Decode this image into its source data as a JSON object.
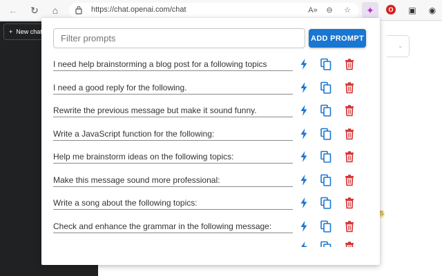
{
  "browser": {
    "url": "https://chat.openai.com/chat",
    "icons": [
      "back-arrow-icon",
      "reload-icon",
      "home-icon",
      "lock-icon",
      "read-aloud-icon",
      "zoom-icon",
      "favorite-icon",
      "extension-active-icon",
      "extension-red-icon",
      "collections-icon",
      "profile-icon"
    ],
    "ext_active_label": "✦",
    "ext_red_label": "O"
  },
  "page": {
    "new_chat_label": "New chat",
    "new_chat_plus": "+",
    "badge": "S"
  },
  "popup": {
    "filter_placeholder": "Filter prompts",
    "add_button_label": "ADD PROMPT",
    "prompts": [
      "I need help brainstorming a blog post for a following topics",
      "I need a good reply for the following.",
      "Rewrite the previous message but make it sound funny.",
      "Write a JavaScript function for the following:",
      "Help me brainstorm ideas on the following topics:",
      "Make this message sound more professional:",
      "Write a song about the following topics:",
      "Check and enhance the grammar in the following message:"
    ],
    "colors": {
      "accent": "#1976d2",
      "run_icon": "#1976d2",
      "copy_icon": "#1976d2",
      "delete_icon": "#d32f2f"
    }
  }
}
